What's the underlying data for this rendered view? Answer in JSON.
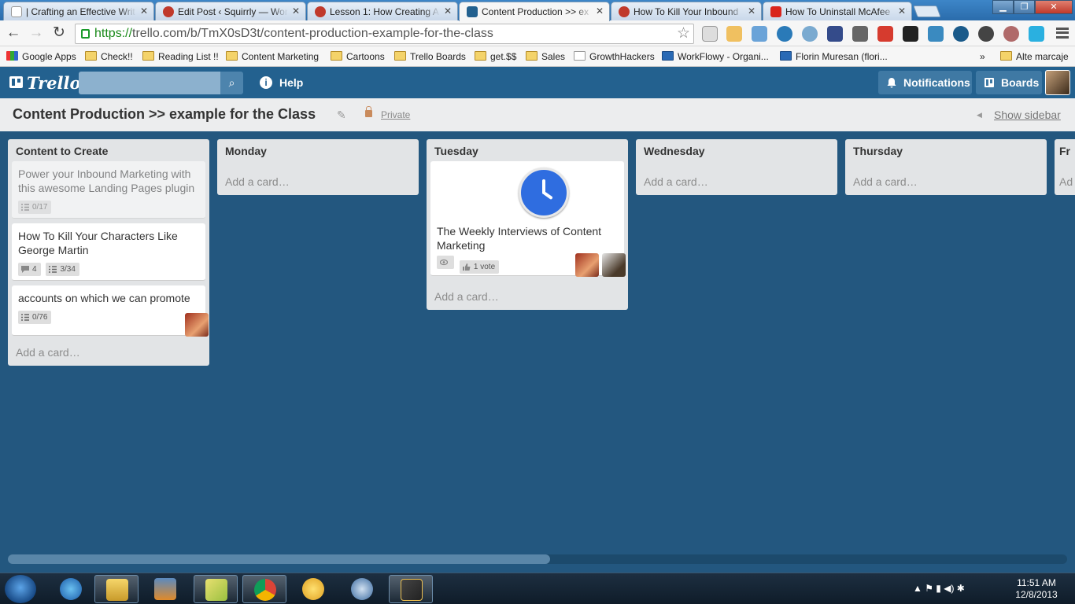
{
  "browser": {
    "tabs": [
      {
        "title": "| Crafting an Effective Writ",
        "icon": "page-icon",
        "color": "#ffffff"
      },
      {
        "title": "Edit Post ‹ Squirrly — Wor",
        "icon": "squirrly-icon",
        "color": "#c0392b"
      },
      {
        "title": "Lesson 1: How Creating A",
        "icon": "squirrly-icon",
        "color": "#c0392b"
      },
      {
        "title": "Content Production >> ex",
        "icon": "trello-icon",
        "color": "#23618f"
      },
      {
        "title": "How To Kill Your Inbound",
        "icon": "squirrly-icon",
        "color": "#c0392b"
      },
      {
        "title": "How To Uninstall McAfee",
        "icon": "youtube-icon",
        "color": "#d9251d"
      }
    ],
    "url_scheme": "https://",
    "url_rest": "trello.com/b/TmX0sD3t/content-production-example-for-the-class",
    "bookmarks": [
      {
        "label": "Google Apps",
        "icon": "apps-grid-icon"
      },
      {
        "label": "Check!!",
        "icon": "folder-icon"
      },
      {
        "label": "Reading List !!",
        "icon": "folder-icon"
      },
      {
        "label": "Content Marketing",
        "icon": "folder-icon"
      },
      {
        "label": "Cartoons",
        "icon": "folder-icon"
      },
      {
        "label": "Trello Boards",
        "icon": "folder-icon"
      },
      {
        "label": "get.$$",
        "icon": "folder-icon"
      },
      {
        "label": "Sales",
        "icon": "folder-icon"
      },
      {
        "label": "GrowthHackers",
        "icon": "page-icon"
      },
      {
        "label": "WorkFlowy - Organi...",
        "icon": "workflowy-icon"
      },
      {
        "label": "Florin Muresan (flori...",
        "icon": "trello-icon"
      }
    ],
    "bookmarks_overflow": "»",
    "other_bookmarks": "Alte marcaje"
  },
  "trello": {
    "logo": "Trello",
    "help": "Help",
    "notifications": "Notifications",
    "boards": "Boards"
  },
  "board": {
    "title": "Content Production >> example for the Class",
    "privacy": "Private",
    "show_sidebar": "Show sidebar",
    "add_card": "Add a card…",
    "lists": [
      {
        "name": "Content to Create"
      },
      {
        "name": "Monday"
      },
      {
        "name": "Tuesday"
      },
      {
        "name": "Wednesday"
      },
      {
        "name": "Thursday"
      },
      {
        "name": "Fr"
      }
    ],
    "cards": {
      "c1": {
        "title": "Power your Inbound Marketing with this awesome Landing Pages plugin",
        "checklist": "0/17"
      },
      "c2": {
        "title": "How To Kill Your Characters Like George Martin",
        "comments": "4",
        "checklist": "3/34"
      },
      "c3": {
        "title": "accounts on which we can promote",
        "checklist": "0/76"
      },
      "c4": {
        "title": "The Weekly Interviews of Content Marketing",
        "votes": "1 vote"
      }
    },
    "add_card_short": "Ad"
  },
  "taskbar": {
    "time": "11:51 AM",
    "date": "12/8/2013"
  }
}
